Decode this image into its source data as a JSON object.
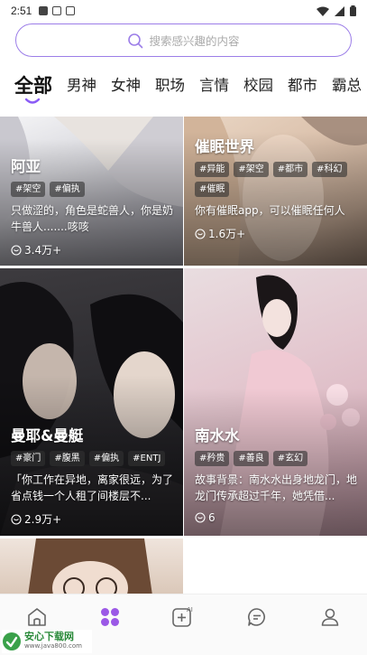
{
  "status_bar": {
    "time": "2:51"
  },
  "search": {
    "placeholder": "搜索感兴趣的内容"
  },
  "tabs": [
    {
      "label": "全部"
    },
    {
      "label": "男神"
    },
    {
      "label": "女神"
    },
    {
      "label": "职场"
    },
    {
      "label": "言情"
    },
    {
      "label": "校园"
    },
    {
      "label": "都市"
    },
    {
      "label": "霸总"
    }
  ],
  "cards": [
    {
      "name": "阿亚",
      "tags": [
        "#架空",
        "#偏执"
      ],
      "desc": "只做涩的，角色是蛇兽人，你是奶牛兽人.......咳咳",
      "count": "3.4万+"
    },
    {
      "name": "催眠世界",
      "tags": [
        "#异能",
        "#架空",
        "#都市",
        "#科幻",
        "#催眠"
      ],
      "desc": "你有催眠app，可以催眠任何人",
      "count": "1.6万+"
    },
    {
      "name": "曼耶&曼艇",
      "tags": [
        "#豪门",
        "#腹黑",
        "#偏执",
        "#ENTJ"
      ],
      "desc": "「你工作在异地，离家很远，为了省点钱一个人租了间楼层不...",
      "count": "2.9万+"
    },
    {
      "name": "南水水",
      "tags": [
        "#矜贵",
        "#善良",
        "#玄幻"
      ],
      "desc": "故事背景：南水水出身地龙门，地龙门传承超过千年，她凭借...",
      "count": "6"
    }
  ],
  "watermark": {
    "title": "安心下载网",
    "url": "www.java800.com"
  },
  "colors": {
    "accent": "#8b5cf6",
    "search_border": "#9c7ee8",
    "active_nav": "#9b59e6"
  }
}
